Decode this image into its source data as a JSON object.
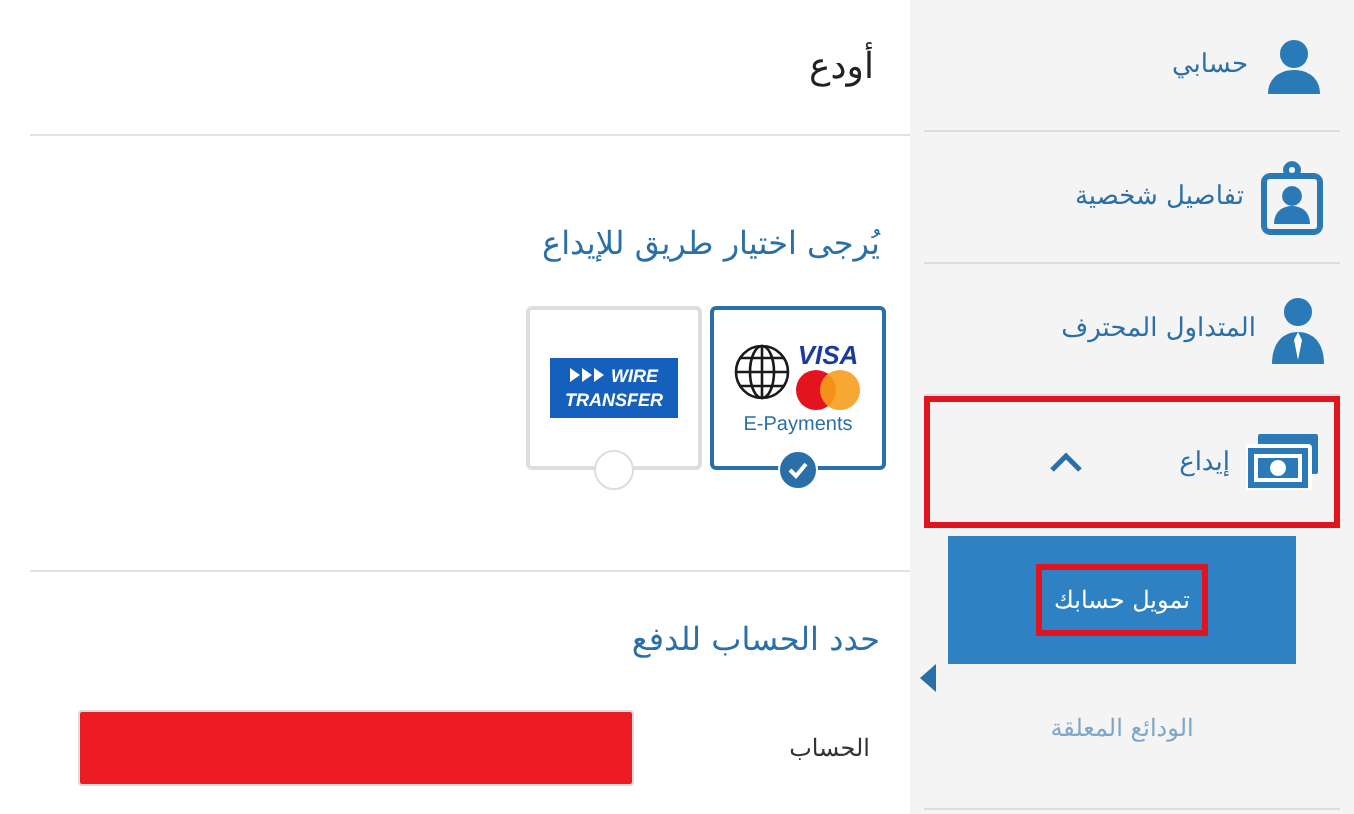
{
  "page": {
    "title": "أودع"
  },
  "methods_section": {
    "heading": "يُرجى اختيار طريق للإيداع",
    "methods": [
      {
        "kind": "card",
        "brand": "VISA",
        "caption": "E-Payments",
        "selected": true
      },
      {
        "kind": "wire",
        "brand": "WIRE",
        "caption": "TRANSFER",
        "selected": false
      }
    ]
  },
  "account_section": {
    "heading": "حدد الحساب للدفع",
    "field_label": "الحساب",
    "field_redacted": true
  },
  "sidebar": {
    "items": [
      {
        "kind": "person",
        "label": "حسابي",
        "highlighted": false
      },
      {
        "kind": "badge",
        "label": "تفاصيل شخصية",
        "highlighted": false
      },
      {
        "kind": "trader",
        "label": "المتداول المحترف",
        "highlighted": false
      },
      {
        "kind": "money",
        "label": "إيداع",
        "expanded": true,
        "highlighted": true,
        "children": [
          {
            "label": "تمويل حسابك",
            "selected": true,
            "highlighted": true
          },
          {
            "label": "الودائع المعلقة",
            "selected": false,
            "highlighted": false
          }
        ]
      }
    ]
  }
}
